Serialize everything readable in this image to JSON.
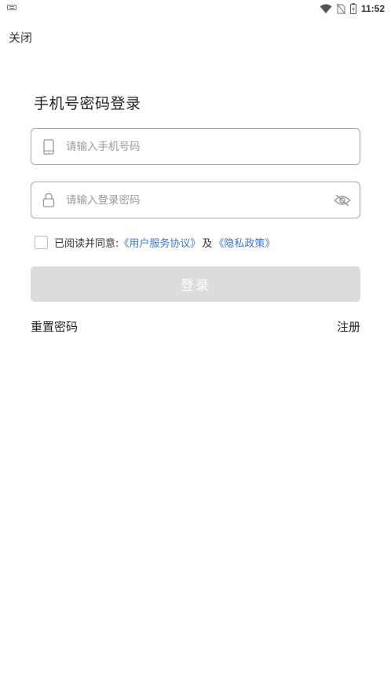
{
  "status_bar": {
    "time": "11:52",
    "icons": [
      "keyboard-icon",
      "wifi-icon",
      "no-sim-icon",
      "battery-icon"
    ]
  },
  "header": {
    "close_label": "关闭"
  },
  "login": {
    "title": "手机号密码登录",
    "phone_placeholder": "请输入手机号码",
    "password_placeholder": "请输入登录密码",
    "agree_text": "已阅读并同意:",
    "user_agreement_link": "《用户服务协议》",
    "and_text": "及",
    "privacy_policy_link": "《隐私政策》",
    "login_button": "登录",
    "reset_password": "重置密码",
    "register": "注册"
  },
  "colors": {
    "link_blue": "#3a78d8",
    "button_disabled": "#dcdcde",
    "border": "#a8a8a8"
  }
}
